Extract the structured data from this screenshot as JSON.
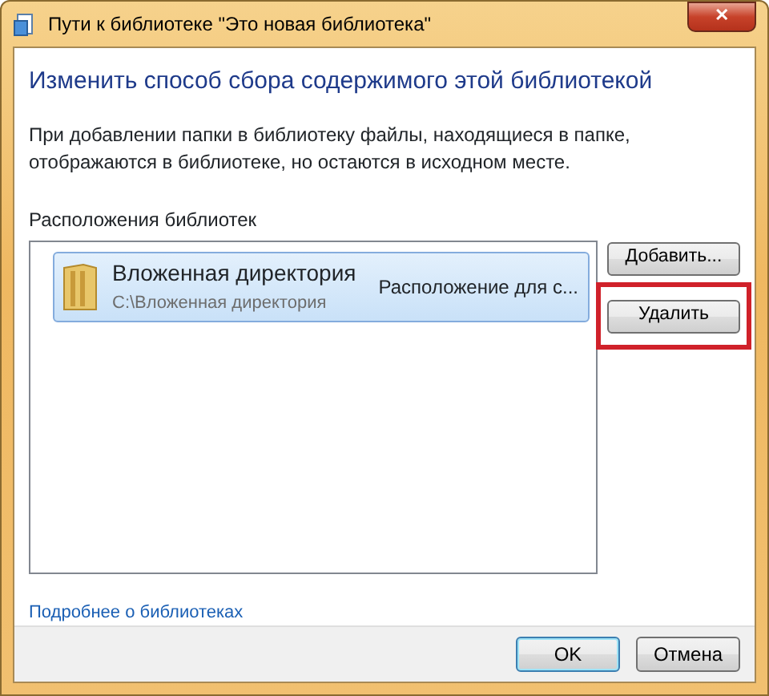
{
  "window": {
    "title": "Пути к библиотеке \"Это новая библиотека\"",
    "close": "✕"
  },
  "heading": "Изменить способ сбора содержимого этой библиотекой",
  "description": "При добавлении папки в библиотеку файлы, находящиеся в папке, отображаются в библиотеке, но остаются в исходном месте.",
  "locations_label": "Расположения библиотек",
  "locations": [
    {
      "name": "Вложенная директория",
      "path": "C:\\Вложенная директория",
      "status": "Расположение для с...",
      "selected": true
    }
  ],
  "side_buttons": [
    {
      "label": "Добавить...",
      "highlighted": false
    },
    {
      "label": "Удалить",
      "highlighted": true
    }
  ],
  "link": "Подробнее о библиотеках",
  "buttons": [
    {
      "label": "OK",
      "default": true
    },
    {
      "label": "Отмена",
      "default": false
    }
  ]
}
